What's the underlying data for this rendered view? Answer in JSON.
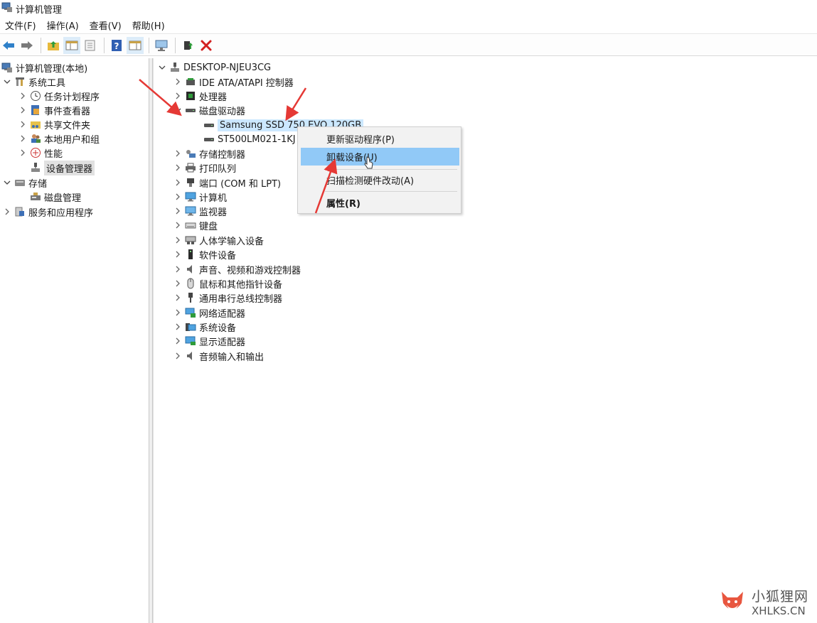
{
  "window": {
    "title": "计算机管理"
  },
  "menubar": [
    {
      "label": "文件(F)"
    },
    {
      "label": "操作(A)"
    },
    {
      "label": "查看(V)"
    },
    {
      "label": "帮助(H)"
    }
  ],
  "toolbar_icons": [
    "back-arrow-icon",
    "forward-arrow-icon",
    "up-folder-icon",
    "show-hide-tree-icon",
    "properties-icon",
    "help-icon",
    "action-pane-icon",
    "monitor-icon",
    "update-driver-icon",
    "uninstall-icon"
  ],
  "left_tree": {
    "root": "计算机管理(本地)",
    "system_tools": "系统工具",
    "task_scheduler": "任务计划程序",
    "event_viewer": "事件查看器",
    "shared_folders": "共享文件夹",
    "local_users": "本地用户和组",
    "performance": "性能",
    "device_manager": "设备管理器",
    "storage": "存储",
    "disk_management": "磁盘管理",
    "services_apps": "服务和应用程序"
  },
  "device_tree": {
    "computer_name": "DESKTOP-NJEU3CG",
    "categories": [
      {
        "label": "IDE ATA/ATAPI 控制器"
      },
      {
        "label": "处理器"
      },
      {
        "label": "磁盘驱动器"
      },
      {
        "label": "存储控制器"
      },
      {
        "label": "打印队列"
      },
      {
        "label": "端口 (COM 和 LPT)"
      },
      {
        "label": "计算机"
      },
      {
        "label": "监视器"
      },
      {
        "label": "键盘"
      },
      {
        "label": "人体学输入设备"
      },
      {
        "label": "软件设备"
      },
      {
        "label": "声音、视频和游戏控制器"
      },
      {
        "label": "鼠标和其他指针设备"
      },
      {
        "label": "通用串行总线控制器"
      },
      {
        "label": "网络适配器"
      },
      {
        "label": "系统设备"
      },
      {
        "label": "显示适配器"
      },
      {
        "label": "音频输入和输出"
      }
    ],
    "disks": [
      {
        "label": "Samsung SSD 750 EVO 120GB"
      },
      {
        "label": "ST500LM021-1KJ"
      }
    ]
  },
  "context_menu": {
    "items": [
      {
        "label": "更新驱动程序(P)"
      },
      {
        "label": "卸载设备(U)"
      },
      {
        "label": "扫描检测硬件改动(A)"
      },
      {
        "label": "属性(R)"
      }
    ]
  },
  "watermark": {
    "cn": "小狐狸网",
    "en": "XHLKS.CN"
  },
  "colors": {
    "menu_highlight": "#91c9f7",
    "selection": "#cce8ff",
    "annotation_arrow": "#e53935"
  }
}
